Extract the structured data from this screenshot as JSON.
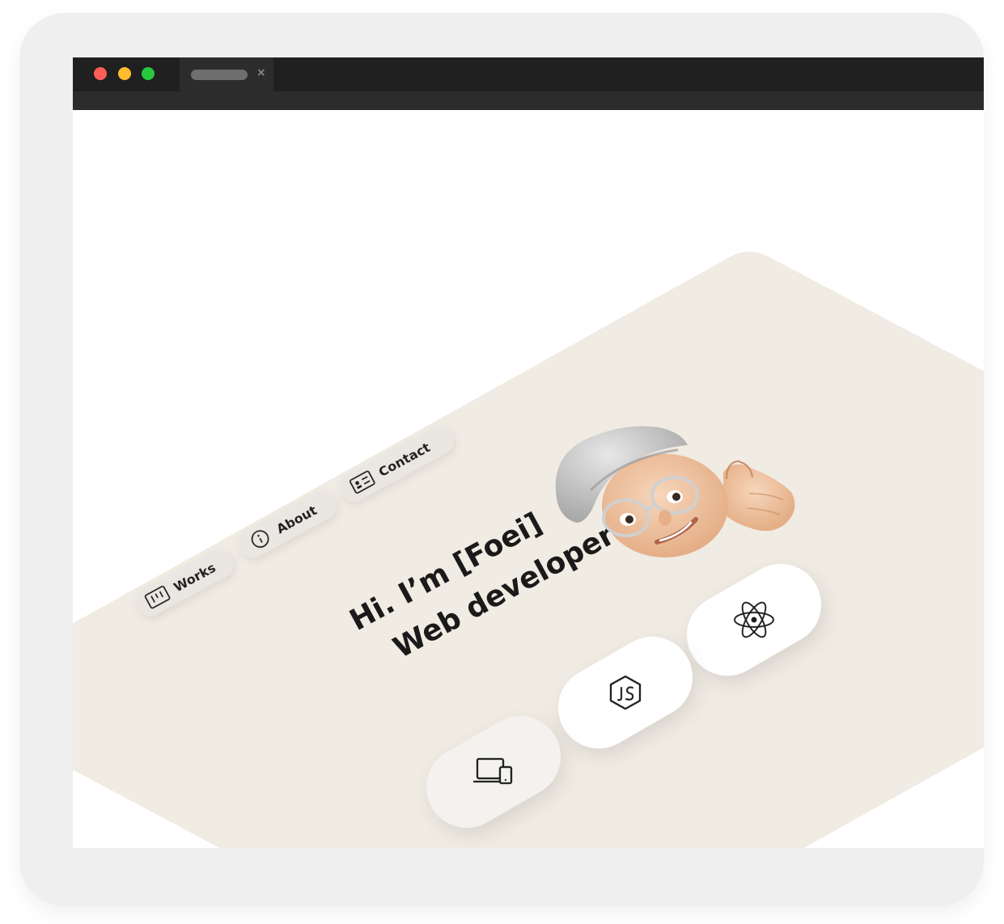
{
  "colors": {
    "page_background": "#ffffff",
    "outer_frame": "#efefef",
    "titlebar": "#202020",
    "toolbar": "#2c2c2c",
    "traffic_close": "#ff5f57",
    "traffic_minimize": "#febc2e",
    "traffic_maximize": "#28c840",
    "plane": "#f0ebe3",
    "pill": "#eae7e2",
    "tile": "#ffffff",
    "tile_muted": "#f4f2ef",
    "text_dark": "#1a1a1a"
  },
  "browser": {
    "tab_close_glyph": "×"
  },
  "nav": {
    "works": {
      "label": "Works",
      "icon": "kanban-board-icon"
    },
    "about": {
      "label": "About",
      "icon": "info-circle-icon"
    },
    "contact": {
      "label": "Contact",
      "icon": "contact-card-icon"
    }
  },
  "hero": {
    "line1": "Hi. I’m [Foei]",
    "line2": "Web developer",
    "avatar_icon": "memoji-thumbs-pointing-avatar"
  },
  "tiles": [
    {
      "icon": "react-atom-icon"
    },
    {
      "icon": "javascript-js-icon"
    },
    {
      "icon": "responsive-devices-icon"
    }
  ]
}
